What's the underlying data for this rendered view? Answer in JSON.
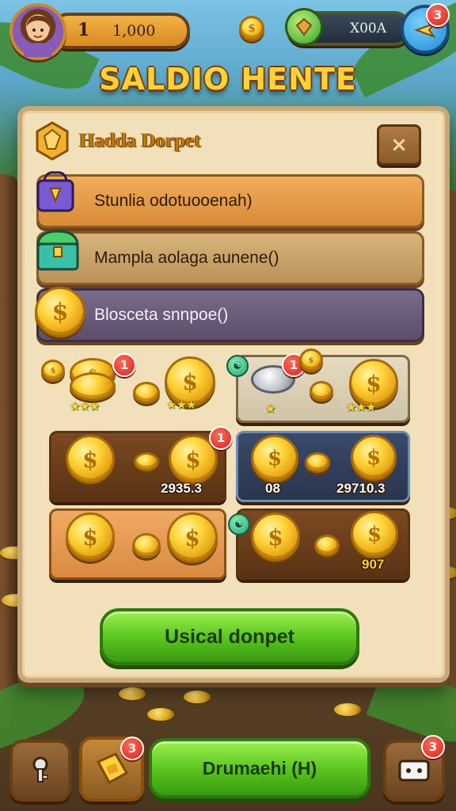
{
  "top_bar": {
    "level": "1",
    "gold": "1,000",
    "small_coin_symbol": "$",
    "gems": "X00A",
    "notif_count": "3"
  },
  "title": "SALDIO HENTE",
  "panel": {
    "header": "Hadda Dorpet",
    "close_symbol": "×",
    "rows": [
      {
        "label": "Stunlia odotuooenah)",
        "color": "#e39b4a"
      },
      {
        "label": "Mampla aolaga aunene()",
        "color": "#c9a36a"
      },
      {
        "label": "Blosceta snnpoe()",
        "color": "#6a5c78"
      }
    ],
    "offers": [
      {
        "badge": "1",
        "amount": "",
        "stars": "★★★"
      },
      {
        "badge": "1",
        "amount": "",
        "stars": "★"
      },
      {
        "badge": "1",
        "amount": "2935.3",
        "stars": ""
      },
      {
        "badge": "",
        "amount": "08",
        "amount2": "29710.3",
        "stars": ""
      },
      {
        "badge": "",
        "amount": "",
        "stars": ""
      },
      {
        "badge": "",
        "amount": "907",
        "stars": ""
      }
    ],
    "cta": "Usical donpet"
  },
  "bottom_bar": {
    "main_button": "Drumaehi (H)",
    "chest_badge": "3",
    "shop_badge": "3"
  },
  "icons": {
    "coin_symbol": "$",
    "accent": "#ffd23a"
  }
}
